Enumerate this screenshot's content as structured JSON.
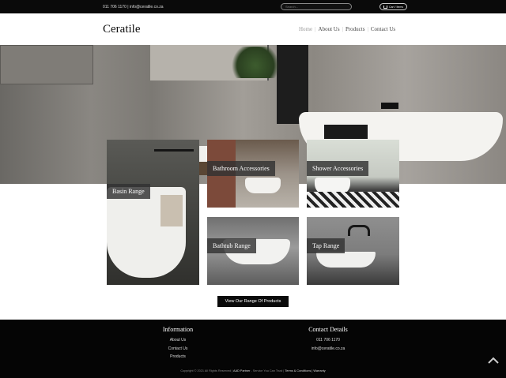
{
  "topbar": {
    "contact_text": "011 706 1170  |  info@ceratile.co.za",
    "search_placeholder": "Search...",
    "cart_label": "Cart / Items"
  },
  "header": {
    "logo": "Ceratile",
    "nav": [
      "Home",
      "About Us",
      "Products",
      "Contact Us"
    ]
  },
  "categories": [
    {
      "label": "Basin Range"
    },
    {
      "label": "Bathroom Accessories"
    },
    {
      "label": "Shower Accessories"
    },
    {
      "label": "Bathtub Range"
    },
    {
      "label": "Tap Range"
    }
  ],
  "view_button": "View Our Range Of Products",
  "footer": {
    "info_title": "Information",
    "info_items": [
      "About Us",
      "Contact Us",
      "Products"
    ],
    "contact_title": "Contact Details",
    "phone": "011 706 1170",
    "email": "info@ceratile.co.za",
    "copyright_prefix": "Copyright © 2021 All Rights Reserved |",
    "copyright_agency": "AAD Partner",
    "copyright_mid": "- Service You Can Trust |",
    "copyright_links": "Terms & Conditions | Warranty"
  }
}
